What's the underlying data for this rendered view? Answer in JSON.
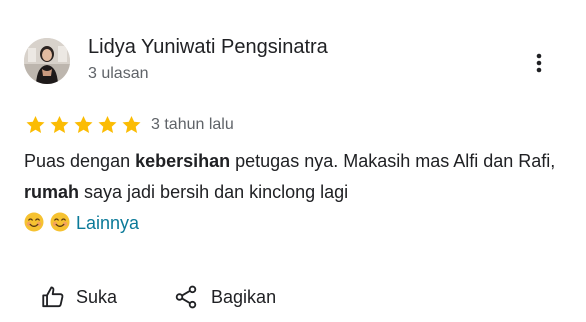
{
  "review": {
    "author_name": "Lidya Yuniwati Pengsinatra",
    "author_reviews": "3 ulasan",
    "rating": 5,
    "date": "3 tahun lalu",
    "text": {
      "p1": "Puas dengan ",
      "b1": "kebersihan",
      "p2": " petugas nya. Makasih mas Alfi dan Rafi, ",
      "b2": "rumah",
      "p3": " saya jadi bersih dan kinclong lagi",
      "emojis": [
        "smiling-face-with-smiling-eyes",
        "smiling-face-with-smiling-eyes"
      ]
    },
    "more_label": "Lainnya"
  },
  "actions": {
    "like_label": "Suka",
    "share_label": "Bagikan"
  },
  "icons": {
    "menu": "more-vert-icon",
    "star": "star-icon",
    "like": "thumb-up-icon",
    "share": "share-icon"
  },
  "colors": {
    "star": "#fbbc04",
    "link": "#0b7a99",
    "secondary_text": "#5f6368",
    "primary_text": "#202124"
  }
}
